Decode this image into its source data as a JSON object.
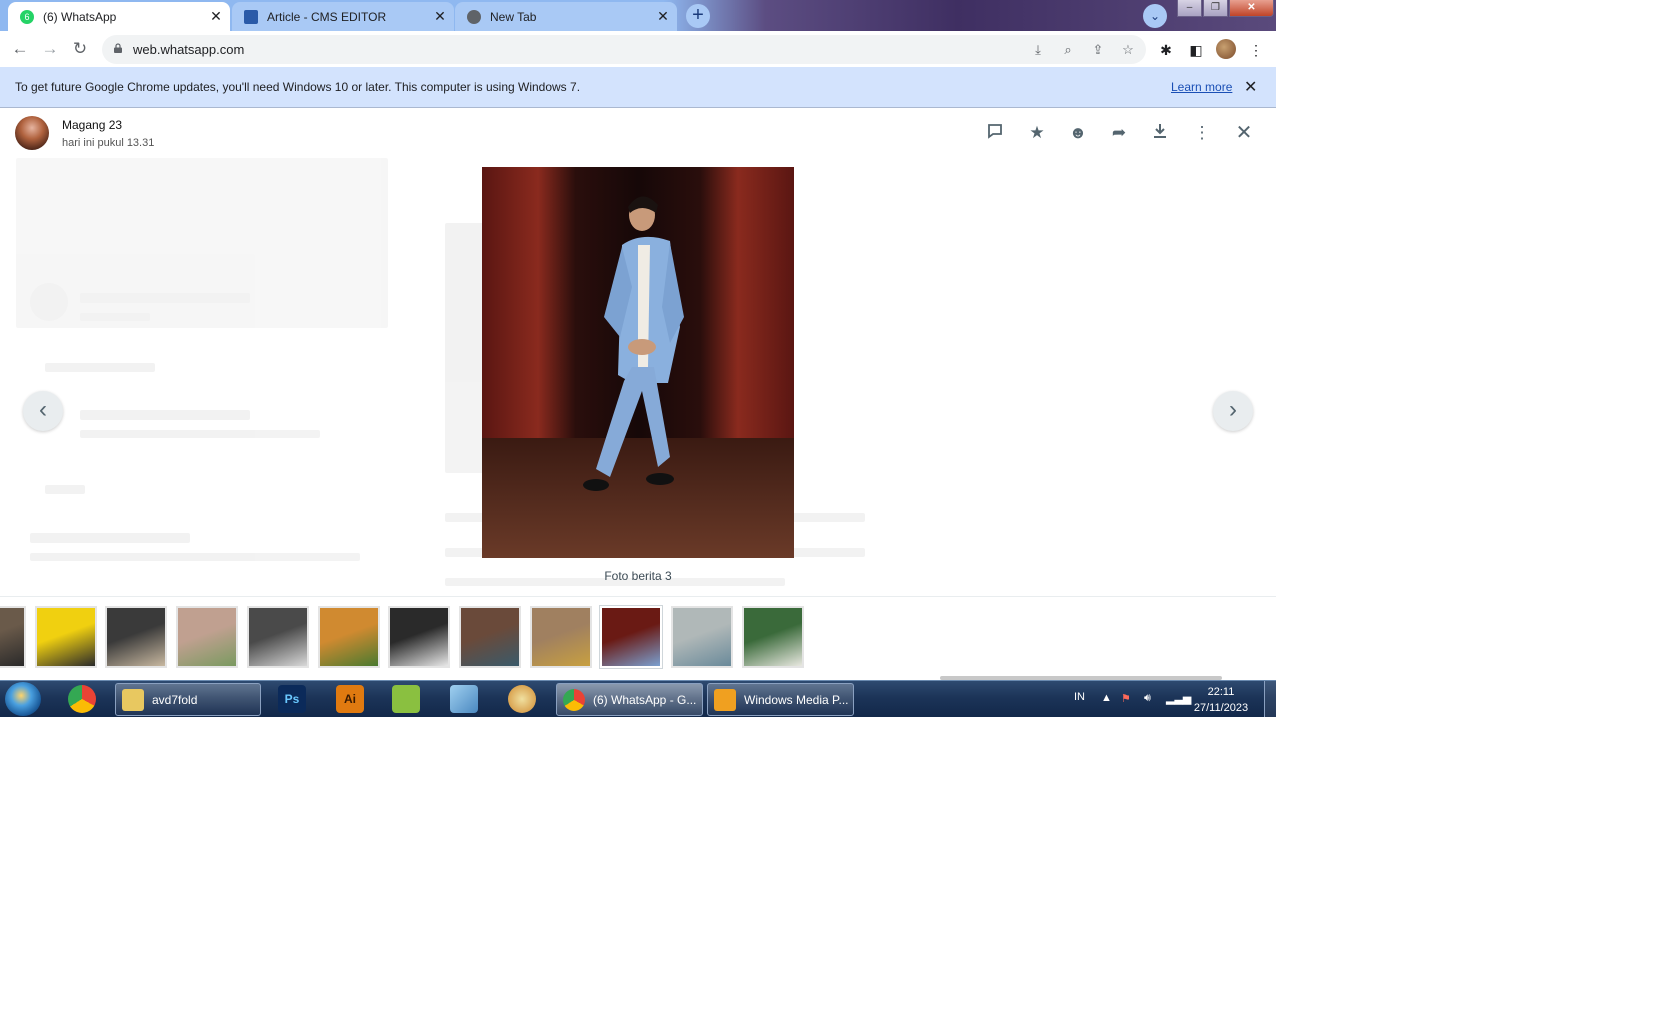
{
  "browser": {
    "tabs": [
      {
        "label": "(6) WhatsApp",
        "favicon": "whatsapp-icon",
        "badge": "6",
        "color": "#25d366"
      },
      {
        "label": "Article - CMS EDITOR",
        "favicon": "cms-icon",
        "color": "#2a5aa8"
      },
      {
        "label": "New Tab",
        "favicon": "chrome-icon",
        "color": "#5f6368"
      }
    ],
    "new_tab_symbol": "+",
    "tab_search_symbol": "⌄",
    "url": "web.whatsapp.com"
  },
  "infobar": {
    "message": "To get future Google Chrome updates, you'll need Windows 10 or later. This computer is using Windows 7.",
    "link": "Learn more",
    "close_symbol": "✕"
  },
  "viewer": {
    "contact_name": "Magang 23",
    "timestamp": "hari ini pukul 13.31",
    "caption": "Foto berita 3",
    "selected_thumbnail": 9,
    "thumbnails": [
      {
        "colors": [
          "#6a5a4a",
          "#2a2a2a"
        ]
      },
      {
        "colors": [
          "#f0d010",
          "#2a2a2a"
        ]
      },
      {
        "colors": [
          "#3a3a3a",
          "#c8b8a0"
        ]
      },
      {
        "colors": [
          "#c0a090",
          "#7a9a60"
        ]
      },
      {
        "colors": [
          "#4a4a4a",
          "#d8d8d8"
        ]
      },
      {
        "colors": [
          "#d08a30",
          "#4a7a30"
        ]
      },
      {
        "colors": [
          "#2a2a2a",
          "#e8e8e8"
        ]
      },
      {
        "colors": [
          "#6a4a3a",
          "#3a5a6a"
        ]
      },
      {
        "colors": [
          "#a08060",
          "#c8a040"
        ]
      },
      {
        "colors": [
          "#6a1a14",
          "#7aa0d0"
        ]
      },
      {
        "colors": [
          "#b0b8b8",
          "#6a8a9a"
        ]
      },
      {
        "colors": [
          "#3a6a3a",
          "#e8e8e0"
        ]
      }
    ]
  },
  "taskbar": {
    "pinned": [
      {
        "label": "Ps",
        "color": "#0b2a5a"
      },
      {
        "label": "Ai",
        "color": "#e07a10"
      }
    ],
    "windows": [
      {
        "label": "avd7fold",
        "color": "#e8c860"
      },
      {
        "label": "(6) WhatsApp - G...",
        "color": "#e8e8e8"
      },
      {
        "label": "Windows Media P...",
        "color": "#f0a020"
      }
    ],
    "lang": "IN",
    "time": "22:11",
    "date": "27/11/2023"
  }
}
